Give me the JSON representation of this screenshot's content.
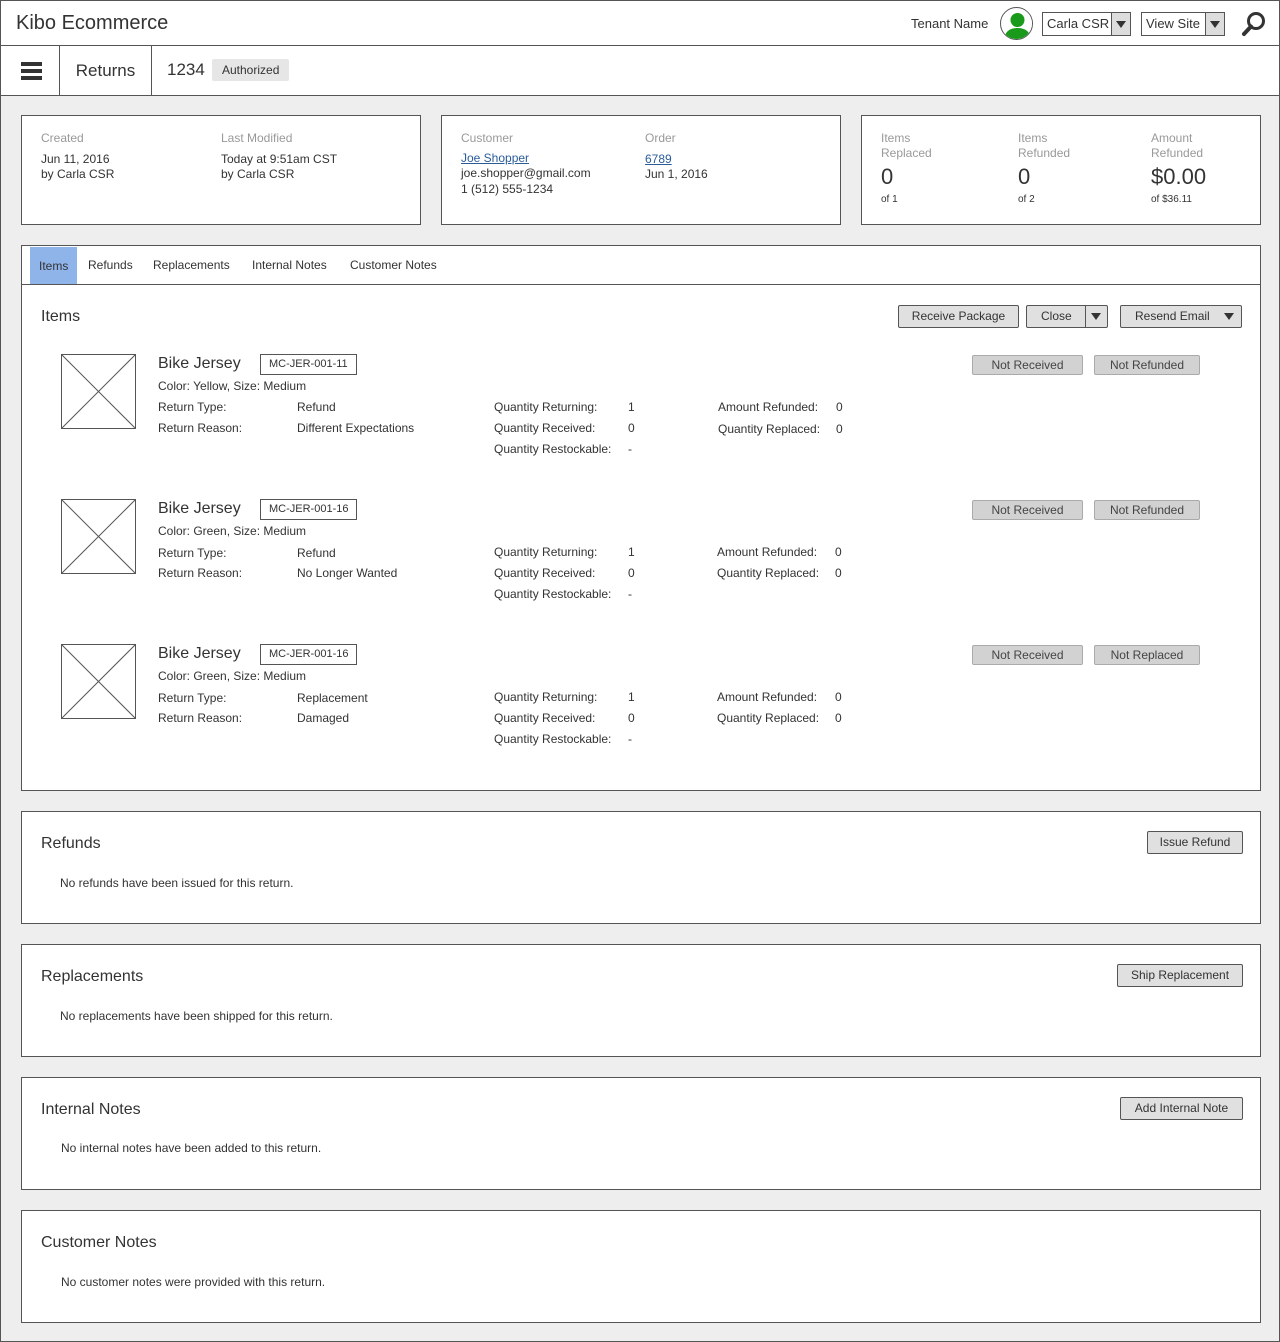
{
  "app": {
    "brand": "Kibo Ecommerce",
    "tenant": "Tenant Name",
    "user_select": "Carla CSR",
    "site_select": "View Site"
  },
  "subbar": {
    "breadcrumb": "Returns",
    "return_id": "1234",
    "status": "Authorized"
  },
  "summary": {
    "created_label": "Created",
    "created_date": "Jun 11, 2016",
    "created_by": "by Carla CSR",
    "modified_label": "Last Modified",
    "modified_date": "Today at 9:51am CST",
    "modified_by": "by Carla CSR",
    "customer_label": "Customer",
    "customer_name": "Joe Shopper",
    "customer_email": "joe.shopper@gmail.com",
    "customer_phone": "1 (512) 555-1234",
    "order_label": "Order",
    "order_number": "6789",
    "order_date": "Jun 1, 2016",
    "replaced_label_1": "Items",
    "replaced_label_2": "Replaced",
    "replaced_value": "0",
    "replaced_of": "of 1",
    "refunded_label_1": "Items",
    "refunded_label_2": "Refunded",
    "refunded_value": "0",
    "refunded_of": "of 2",
    "amount_label_1": "Amount",
    "amount_label_2": "Refunded",
    "amount_value": "$0.00",
    "amount_of": "of $36.11"
  },
  "tabs": [
    {
      "label": "Items"
    },
    {
      "label": "Refunds"
    },
    {
      "label": "Replacements"
    },
    {
      "label": "Internal Notes"
    },
    {
      "label": "Customer Notes"
    }
  ],
  "items_section": {
    "title": "Items",
    "receive_button": "Receive Package",
    "close_button": "Close",
    "resend_button": "Resend Email",
    "labels": {
      "return_type": "Return Type:",
      "return_reason": "Return Reason:",
      "qty_returning": "Quantity Returning:",
      "qty_received": "Quantity Received:",
      "qty_restockable": "Quantity Restockable:",
      "amount_refunded": "Amount Refunded:",
      "qty_replaced": "Quantity Replaced:"
    },
    "items": [
      {
        "name": "Bike Jersey",
        "sku": "MC-JER-001-11",
        "variant": "Color: Yellow, Size: Medium",
        "return_type": "Refund",
        "return_reason": "Different Expectations",
        "qty_returning": "1",
        "qty_received": "0",
        "qty_restockable": "-",
        "amount_refunded": "0",
        "qty_replaced": "0",
        "status_1": "Not Received",
        "status_2": "Not Refunded"
      },
      {
        "name": "Bike Jersey",
        "sku": "MC-JER-001-16",
        "variant": "Color: Green, Size: Medium",
        "return_type": "Refund",
        "return_reason": "No Longer Wanted",
        "qty_returning": "1",
        "qty_received": "0",
        "qty_restockable": "-",
        "amount_refunded": "0",
        "qty_replaced": "0",
        "status_1": "Not Received",
        "status_2": "Not Refunded"
      },
      {
        "name": "Bike Jersey",
        "sku": "MC-JER-001-16",
        "variant": "Color: Green, Size: Medium",
        "return_type": "Replacement",
        "return_reason": "Damaged",
        "qty_returning": "1",
        "qty_received": "0",
        "qty_restockable": "-",
        "amount_refunded": "0",
        "qty_replaced": "0",
        "status_1": "Not Received",
        "status_2": "Not Replaced"
      }
    ]
  },
  "refunds_section": {
    "title": "Refunds",
    "button": "Issue Refund",
    "empty": "No refunds have been issued for this return."
  },
  "replacements_section": {
    "title": "Replacements",
    "button": "Ship Replacement",
    "empty": "No replacements have been shipped for this return."
  },
  "internal_notes_section": {
    "title": "Internal Notes",
    "button": "Add Internal Note",
    "empty": "No internal notes have been added to this return."
  },
  "customer_notes_section": {
    "title": "Customer Notes",
    "empty": "No customer notes were provided with this return."
  },
  "colors": {
    "active_tab": "#8fb4ea",
    "avatar": "#1a9a1a",
    "link": "#2a5c9a"
  }
}
